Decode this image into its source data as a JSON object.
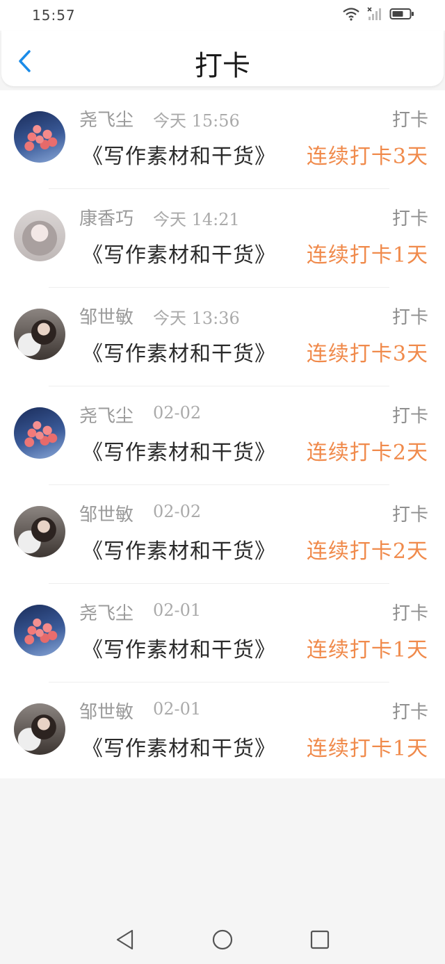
{
  "status_bar": {
    "time": "15:57",
    "icons": [
      "wifi-icon",
      "signal-icon",
      "battery-icon"
    ]
  },
  "header": {
    "title": "打卡",
    "back_icon": "chevron-left-icon",
    "accent_color": "#1a8be8"
  },
  "colors": {
    "streak": "#f08a4b",
    "muted": "#9a9a9a"
  },
  "items": [
    {
      "name": "尧飞尘",
      "time": "今天 15:56",
      "tag": "打卡",
      "group": "《写作素材和干货》",
      "streak": "连续打卡3天",
      "avatar": "balloons"
    },
    {
      "name": "康香巧",
      "time": "今天 14:21",
      "tag": "打卡",
      "group": "《写作素材和干货》",
      "streak": "连续打卡1天",
      "avatar": "anime"
    },
    {
      "name": "邹世敏",
      "time": "今天 13:36",
      "tag": "打卡",
      "group": "《写作素材和干货》",
      "streak": "连续打卡3天",
      "avatar": "photo"
    },
    {
      "name": "尧飞尘",
      "time": "02-02",
      "tag": "打卡",
      "group": "《写作素材和干货》",
      "streak": "连续打卡2天",
      "avatar": "balloons"
    },
    {
      "name": "邹世敏",
      "time": "02-02",
      "tag": "打卡",
      "group": "《写作素材和干货》",
      "streak": "连续打卡2天",
      "avatar": "photo"
    },
    {
      "name": "尧飞尘",
      "time": "02-01",
      "tag": "打卡",
      "group": "《写作素材和干货》",
      "streak": "连续打卡1天",
      "avatar": "balloons"
    },
    {
      "name": "邹世敏",
      "time": "02-01",
      "tag": "打卡",
      "group": "《写作素材和干货》",
      "streak": "连续打卡1天",
      "avatar": "photo"
    }
  ],
  "nav": {
    "icons": [
      "back-triangle-icon",
      "home-circle-icon",
      "recents-square-icon"
    ]
  }
}
